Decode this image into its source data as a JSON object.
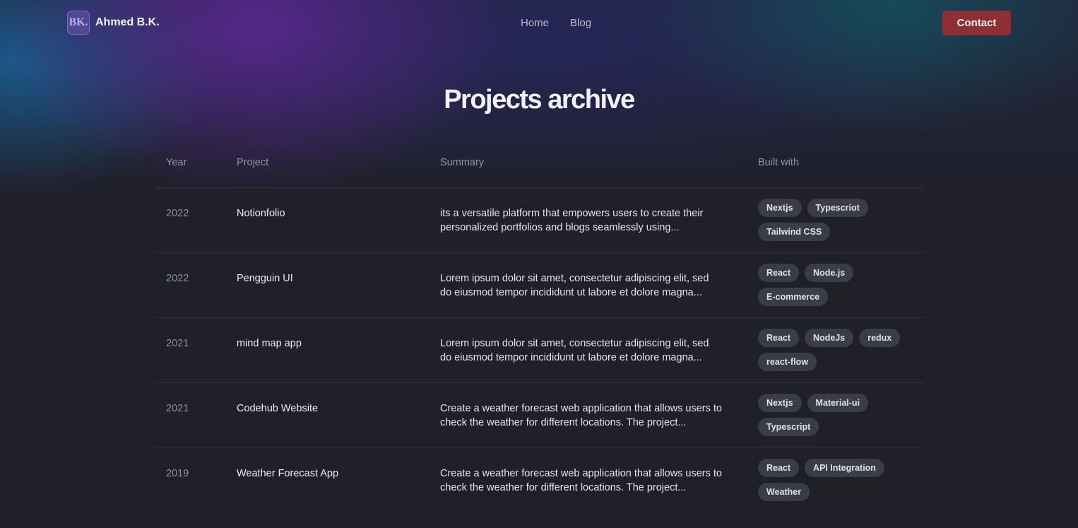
{
  "header": {
    "brand_badge": "BK.",
    "brand_name": "Ahmed B.K.",
    "nav": [
      {
        "label": "Home"
      },
      {
        "label": "Blog"
      }
    ],
    "contact_label": "Contact"
  },
  "page_title": "Projects archive",
  "table": {
    "columns": [
      "Year",
      "Project",
      "Summary",
      "Built with"
    ],
    "rows": [
      {
        "year": "2022",
        "project": "Notionfolio",
        "summary": "its a versatile platform that empowers users to create their personalized portfolios and blogs seamlessly using...",
        "tags": [
          "Nextjs",
          "Typescriot",
          "Tailwind CSS"
        ]
      },
      {
        "year": "2022",
        "project": "Pengguin UI",
        "summary": "Lorem ipsum dolor sit amet, consectetur adipiscing elit, sed do eiusmod tempor incididunt ut labore et dolore magna...",
        "tags": [
          "React",
          "Node.js",
          "E-commerce"
        ]
      },
      {
        "year": "2021",
        "project": "mind map app",
        "summary": "Lorem ipsum dolor sit amet, consectetur adipiscing elit, sed do eiusmod tempor incididunt ut labore et dolore magna...",
        "tags": [
          "React",
          "NodeJs",
          "redux",
          "react-flow"
        ]
      },
      {
        "year": "2021",
        "project": "Codehub Website",
        "summary": "Create a weather forecast web application that allows users to check the weather for different locations. The project...",
        "tags": [
          "Nextjs",
          "Material-ui",
          "Typescript"
        ]
      },
      {
        "year": "2019",
        "project": "Weather Forecast App",
        "summary": "Create a weather forecast web application that allows users to check the weather for different locations. The project...",
        "tags": [
          "React",
          "API Integration",
          "Weather"
        ]
      }
    ]
  },
  "colors": {
    "background": "#1f2027",
    "accent_button": "#8e2f36",
    "tag_background": "#3a3d48",
    "brand_badge": "#6e50b4"
  }
}
